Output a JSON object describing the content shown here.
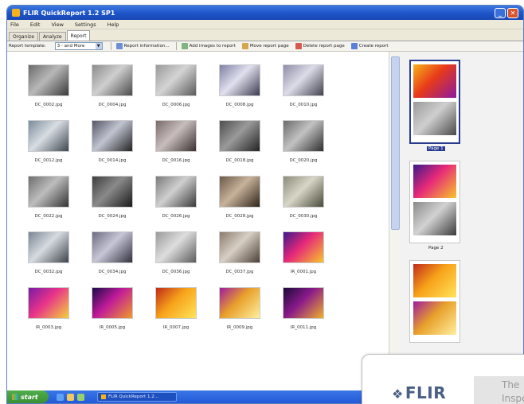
{
  "window": {
    "title": "FLIR QuickReport 1.2 SP1"
  },
  "menu": [
    "File",
    "Edit",
    "View",
    "Settings",
    "Help"
  ],
  "tabs": [
    {
      "label": "Organize",
      "active": false
    },
    {
      "label": "Analyze",
      "active": false
    },
    {
      "label": "Report",
      "active": true
    }
  ],
  "toolbar": {
    "template_label": "Report template:",
    "template_value": "3 - and More",
    "items": [
      "Report information...",
      "Add images to report",
      "Move report page",
      "Delete report page",
      "Create report"
    ]
  },
  "thumbnails": [
    {
      "name": "DC_0002.jpg",
      "palette": [
        "#6b6b6b",
        "#b8b8b8",
        "#3a3a3a"
      ]
    },
    {
      "name": "DC_0004.jpg",
      "palette": [
        "#8c8c8c",
        "#cfcfcf",
        "#4a4a4a"
      ]
    },
    {
      "name": "DC_0006.jpg",
      "palette": [
        "#9a9a9a",
        "#d4d4d4",
        "#5a5a5a"
      ]
    },
    {
      "name": "DC_0008.jpg",
      "palette": [
        "#7f7fa6",
        "#e0e0ee",
        "#3b3b50"
      ]
    },
    {
      "name": "DC_0010.jpg",
      "palette": [
        "#8d8da8",
        "#dcdce8",
        "#40404f"
      ]
    },
    {
      "name": "DC_0012.jpg",
      "palette": [
        "#7a8c9c",
        "#d8dde2",
        "#3e4650"
      ]
    },
    {
      "name": "DC_0014.jpg",
      "palette": [
        "#555566",
        "#c0c4d0",
        "#222"
      ]
    },
    {
      "name": "DC_0016.jpg",
      "palette": [
        "#7a6a6a",
        "#c8bdbd",
        "#3b3030"
      ]
    },
    {
      "name": "DC_0018.jpg",
      "palette": [
        "#4e4e4e",
        "#9a9a9a",
        "#222"
      ]
    },
    {
      "name": "DC_0020.jpg",
      "palette": [
        "#6a6a6a",
        "#c2c2c2",
        "#2e2e2e"
      ]
    },
    {
      "name": "DC_0022.jpg",
      "palette": [
        "#6e6e6e",
        "#bdbdbd",
        "#333"
      ]
    },
    {
      "name": "DC_0024.jpg",
      "palette": [
        "#3e3e3e",
        "#8a8a8a",
        "#1a1a1a"
      ]
    },
    {
      "name": "DC_0026.jpg",
      "palette": [
        "#7b7b7b",
        "#cfcfcf",
        "#3a3a3a"
      ]
    },
    {
      "name": "DC_0028.jpg",
      "palette": [
        "#6b5a4a",
        "#c7b29a",
        "#2e241a"
      ]
    },
    {
      "name": "DC_0030.jpg",
      "palette": [
        "#8c8c7a",
        "#d8d6c6",
        "#4a4a3a"
      ]
    },
    {
      "name": "DC_0032.jpg",
      "palette": [
        "#7a8592",
        "#d6dbe0",
        "#3c434a"
      ]
    },
    {
      "name": "DC_0034.jpg",
      "palette": [
        "#6c6c80",
        "#c6c6d6",
        "#30303e"
      ]
    },
    {
      "name": "DC_0036.jpg",
      "palette": [
        "#9a9a9a",
        "#dedede",
        "#5c5c5c"
      ]
    },
    {
      "name": "DC_0037.jpg",
      "palette": [
        "#8a7c6e",
        "#d8cfc4",
        "#4a3f34"
      ]
    },
    {
      "name": "IR_0001.jpg",
      "palette": [
        "#3a1a8a",
        "#e6287a",
        "#f7c62a"
      ]
    },
    {
      "name": "IR_0003.jpg",
      "palette": [
        "#7a1aa6",
        "#e8338a",
        "#f4d23a"
      ]
    },
    {
      "name": "IR_0005.jpg",
      "palette": [
        "#1a0a4a",
        "#c01a9a",
        "#f09a2a"
      ]
    },
    {
      "name": "IR_0007.jpg",
      "palette": [
        "#c02a1a",
        "#f7a21a",
        "#ffe45a"
      ]
    },
    {
      "name": "IR_0009.jpg",
      "palette": [
        "#a01aa0",
        "#e8a02a",
        "#fff0a0"
      ]
    },
    {
      "name": "IR_0011.jpg",
      "palette": [
        "#1a0a3a",
        "#8a1a8a",
        "#f0b02a"
      ]
    }
  ],
  "report_pages": [
    {
      "label": "Page 1",
      "selected": true,
      "images": [
        [
          "#f7b21b",
          "#e83a1a",
          "#8a1aa0"
        ],
        [
          "#9a9a9a",
          "#cfcfcf",
          "#4a4a4a"
        ]
      ]
    },
    {
      "label": "Page 2",
      "selected": false,
      "images": [
        [
          "#3a1a8a",
          "#e6287a",
          "#f7c62a"
        ],
        [
          "#8a8a8a",
          "#d2d2d2",
          "#3a3a3a"
        ]
      ]
    },
    {
      "label": "",
      "selected": false,
      "images": [
        [
          "#c02a1a",
          "#f7a21a",
          "#ffe45a"
        ],
        [
          "#a01aa0",
          "#e8a02a",
          "#fff0a0"
        ]
      ]
    }
  ],
  "taskbar": {
    "start_label": "start",
    "task_label": "FLIR QuickReport 1.2..."
  },
  "brand": {
    "logo_text": "FLIR",
    "line1": "The",
    "line2": "Inspe",
    "color": "#4a5f86"
  }
}
